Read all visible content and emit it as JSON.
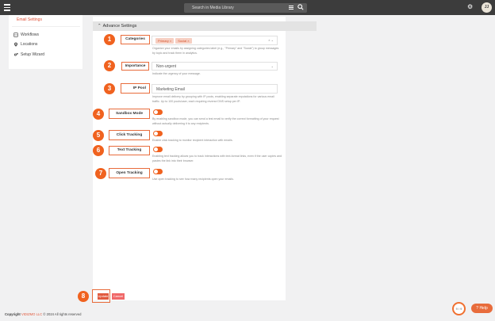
{
  "topbar": {
    "search_placeholder": "Search in Media Library",
    "avatar_initials": "JJ"
  },
  "sidebar": {
    "active_item": "Email Settings",
    "items": [
      {
        "label": "Workflows",
        "icon": "workflow-icon"
      },
      {
        "label": "Locations",
        "icon": "location-pin-icon"
      },
      {
        "label": "Setup Wizard",
        "icon": "gears-icon"
      }
    ]
  },
  "section": {
    "title": "Advance Settings"
  },
  "settings": {
    "categories": {
      "marker": "1",
      "label": "Categories",
      "tags": [
        "Primary ×",
        "Social ×"
      ],
      "description": "Organize your emails by assigning categories label (e.g., \"Primary\" and \"Social\") to group messages by topic and track them in analytics."
    },
    "importance": {
      "marker": "2",
      "label": "Importance",
      "value": "Non-urgent",
      "description": "Indicate the urgency of your message."
    },
    "ip_pool": {
      "marker": "3",
      "label": "IP Pool",
      "value": "Marketing Email",
      "description": "Improve email delivery by grouping with IP pools, enabling separate reputations for various email traffic. Up to 100 pools/user, each requiring reverse DNS setup per IP."
    },
    "sandbox": {
      "marker": "4",
      "label": "Sandbox Mode",
      "description": "By enabling sandbox mode, you can send a test email to verify the correct formatting of your request without actually delivering it to any recipients."
    },
    "click_tracking": {
      "marker": "5",
      "label": "Click Tracking",
      "description": "Enable click tracking to monitor recipient interaction with emails."
    },
    "text_tracking": {
      "marker": "6",
      "label": "Text Tracking",
      "description": "Enabling text tracking allows you to track interactions with text-format links, even if the user copies and pastes the link into their browser."
    },
    "open_tracking": {
      "marker": "7",
      "label": "Open Tracking",
      "description": "Use open tracking to see how many recipients open your emails."
    }
  },
  "actions": {
    "marker": "8",
    "update_label": "Update",
    "cancel_label": "Cancel"
  },
  "footer": {
    "copyright": "Copyright",
    "brand": "VIDIZMO LLC",
    "rest": "© 2024 All rights reserved"
  },
  "corner": {
    "counter": "9 / 9",
    "help_label": "Help"
  },
  "colors": {
    "accent": "#f0621f",
    "topbar": "#3c3c3c",
    "brand": "#e15a3e"
  }
}
